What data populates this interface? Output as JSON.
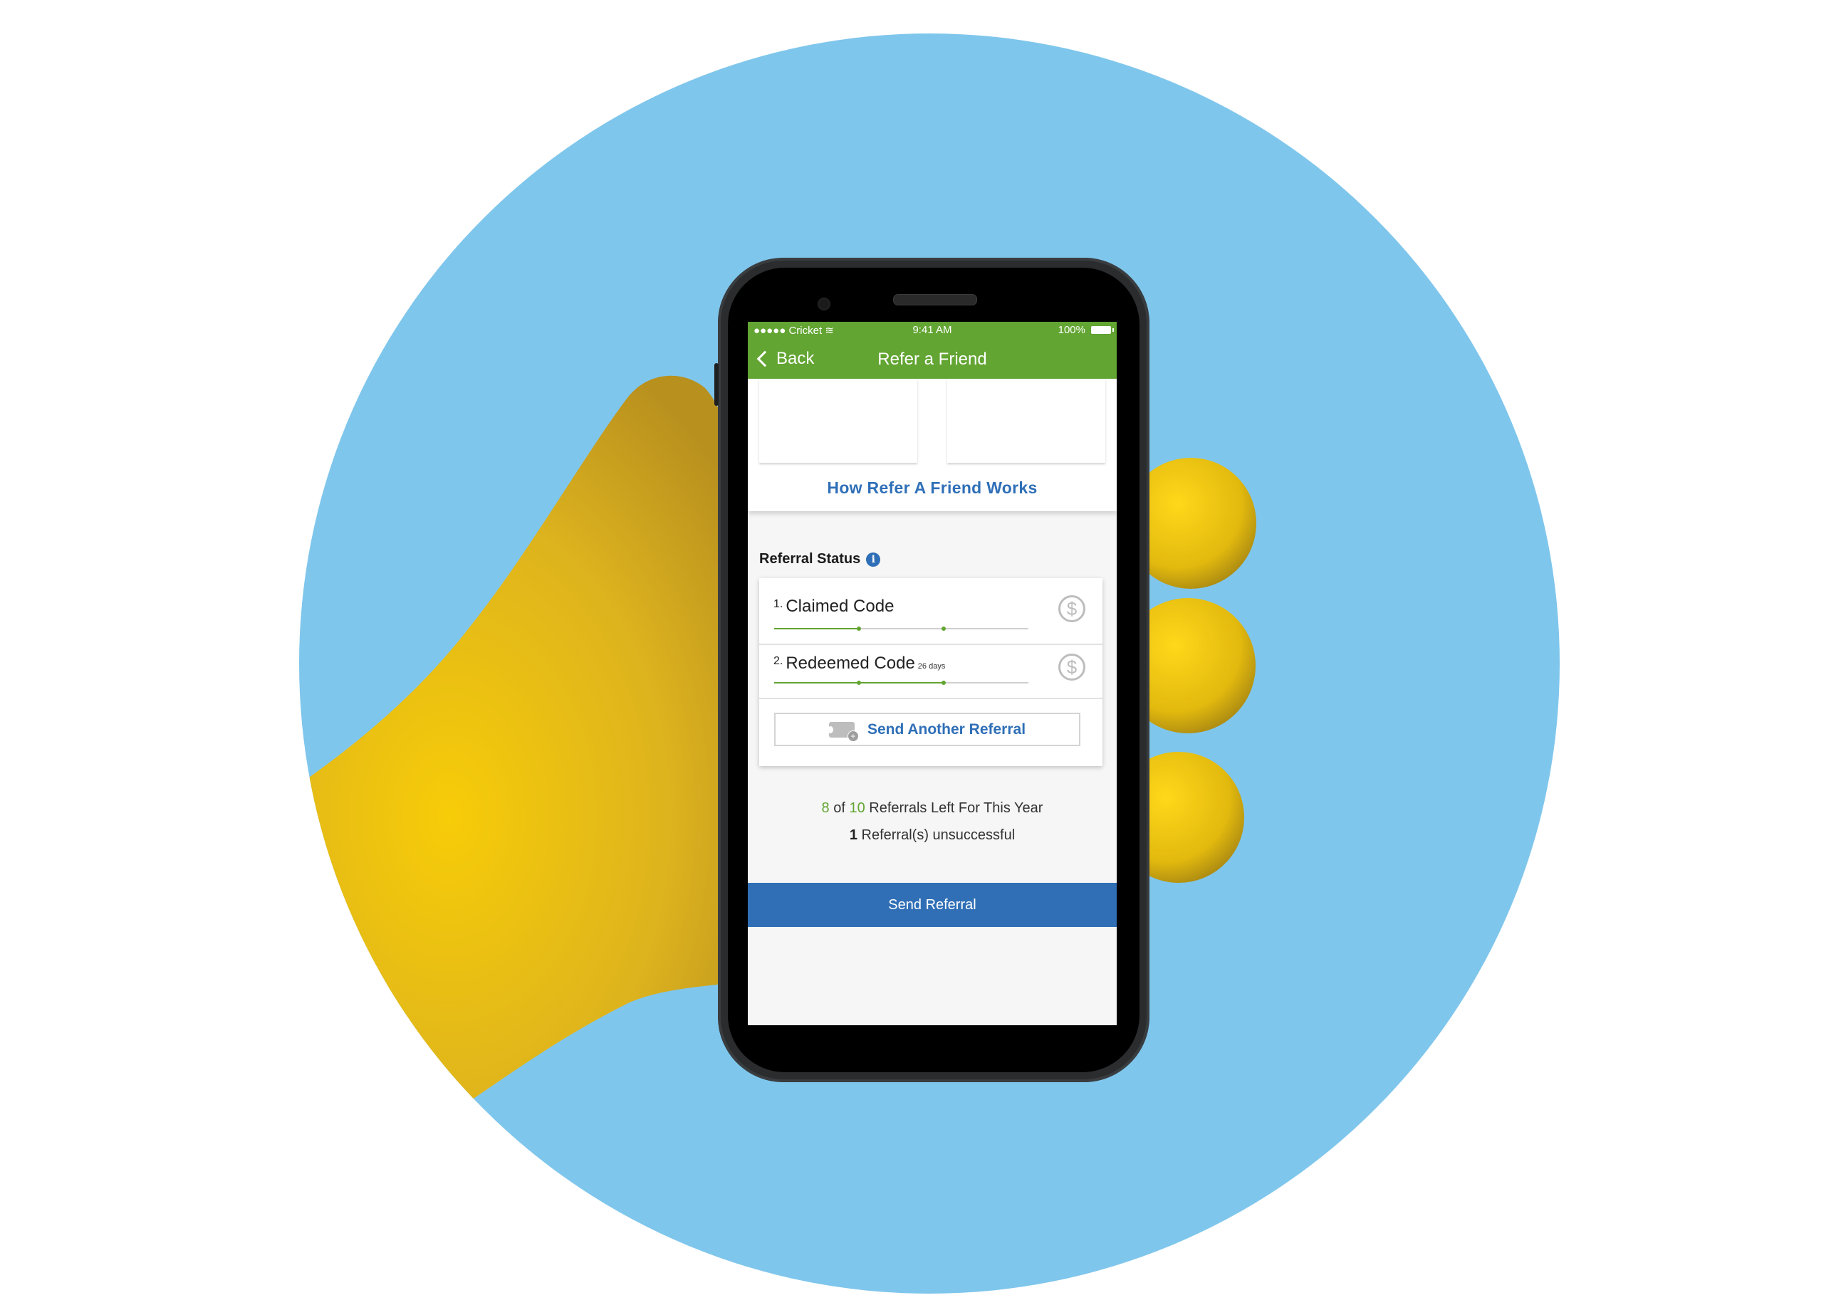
{
  "status_bar": {
    "carrier": "●●●●● Cricket",
    "wifi_icon": "wifi-icon",
    "time": "9:41 AM",
    "battery": "100%"
  },
  "nav": {
    "back_label": "Back",
    "title": "Refer a Friend"
  },
  "how_it_works_link": "How Refer A Friend Works",
  "referral_status": {
    "label": "Referral Status",
    "info_icon": "i",
    "steps": [
      {
        "number": "1.",
        "title": "Claimed Code",
        "days": "",
        "progress_fraction": 0.333,
        "icon": "dollar-circle-icon"
      },
      {
        "number": "2.",
        "title": "Redeemed Code",
        "days": "26 days",
        "progress_fraction": 0.667,
        "icon": "dollar-circle-icon"
      }
    ],
    "send_another_label": "Send Another Referral"
  },
  "stats": {
    "remaining": "8",
    "of_text": " of ",
    "total": "10",
    "remaining_suffix": " Referrals Left For This Year",
    "unsuccessful": "1",
    "unsuccessful_suffix": " Referral(s) unsuccessful"
  },
  "send_referral_label": "Send Referral",
  "colors": {
    "brand_green": "#62a532",
    "brand_blue": "#306fb6",
    "background_circle": "#7fc6ec"
  }
}
